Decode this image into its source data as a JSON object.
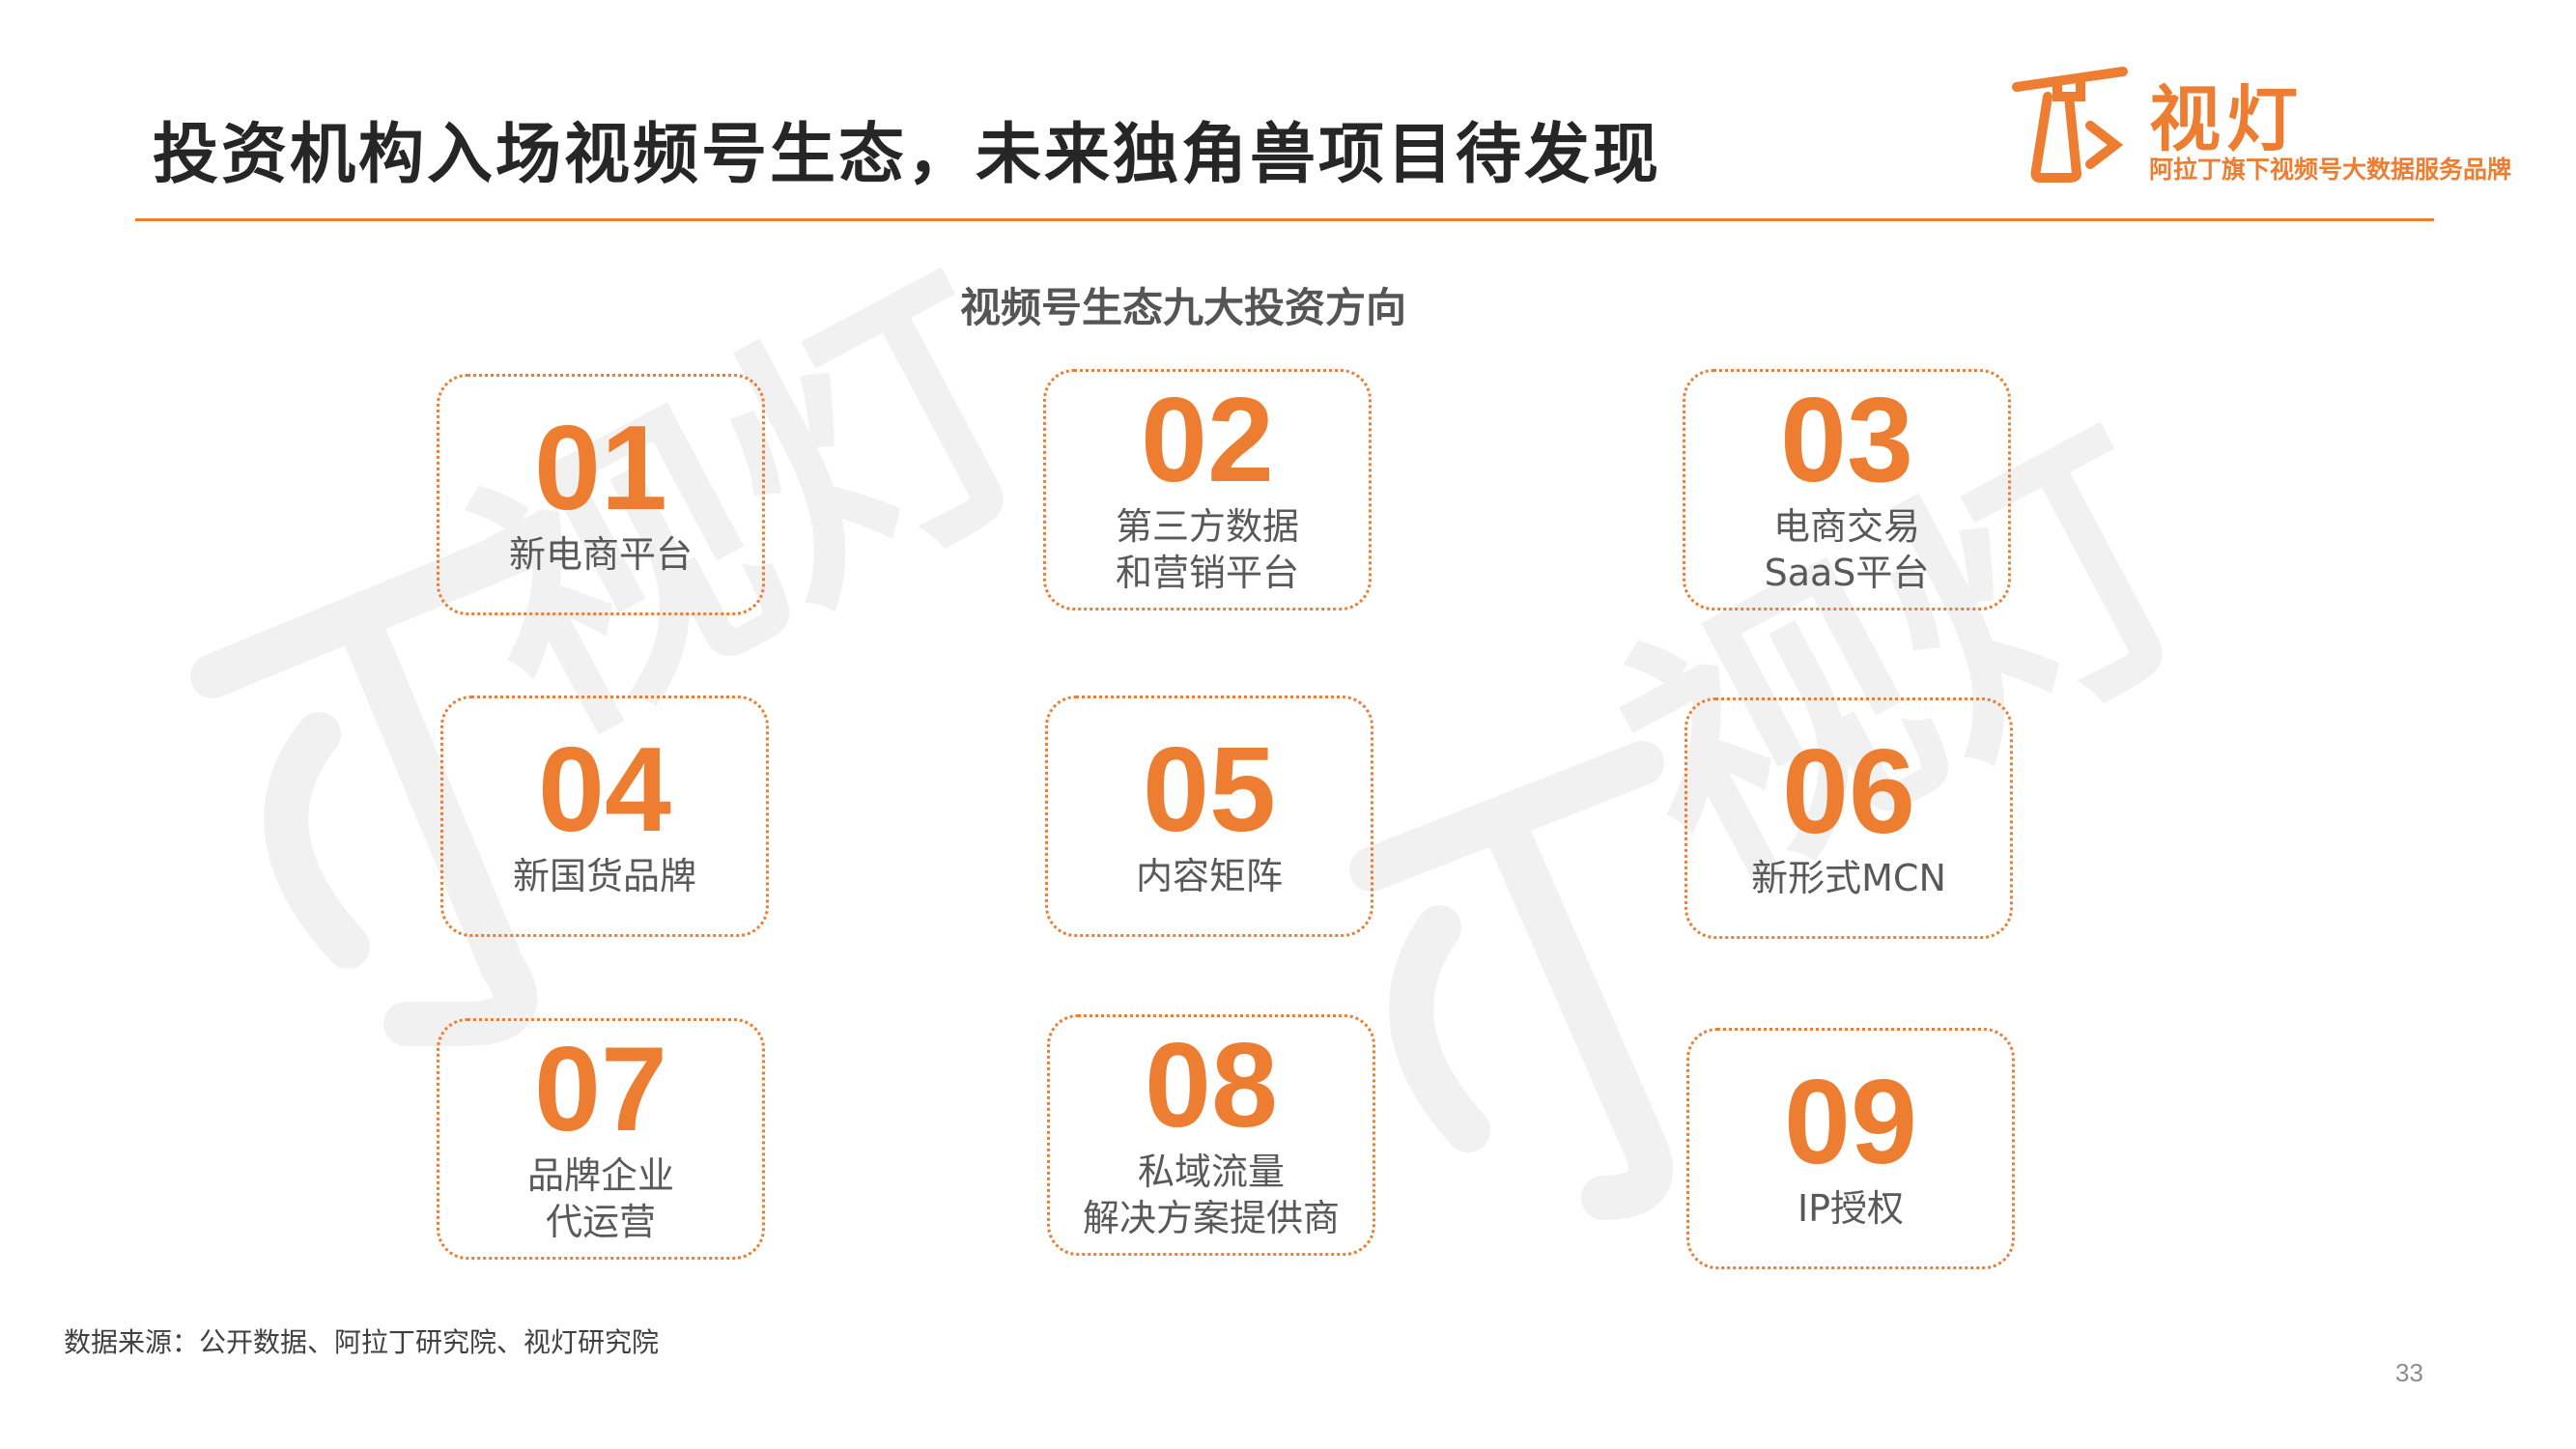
{
  "title": "投资机构入场视频号生态，未来独角兽项目待发现",
  "logo": {
    "name": "视灯",
    "slogan": "阿拉丁旗下视频号大数据服务品牌",
    "accent": "#ED7D31"
  },
  "subtitle": "视频号生态九大投资方向",
  "cards": [
    {
      "num": "01",
      "label": "新电商平台"
    },
    {
      "num": "02",
      "label": "第三方数据\n和营销平台"
    },
    {
      "num": "03",
      "label": "电商交易\nSaaS平台"
    },
    {
      "num": "04",
      "label": "新国货品牌"
    },
    {
      "num": "05",
      "label": "内容矩阵"
    },
    {
      "num": "06",
      "label": "新形式MCN"
    },
    {
      "num": "07",
      "label": "品牌企业\n代运营"
    },
    {
      "num": "08",
      "label": "私域流量\n解决方案提供商"
    },
    {
      "num": "09",
      "label": "IP授权"
    }
  ],
  "source": "数据来源：公开数据、阿拉丁研究院、视灯研究院",
  "page_number": "33",
  "watermark": {
    "text": "视灯",
    "icon": "lighthouse-icon",
    "color": "#f2f2f2"
  }
}
